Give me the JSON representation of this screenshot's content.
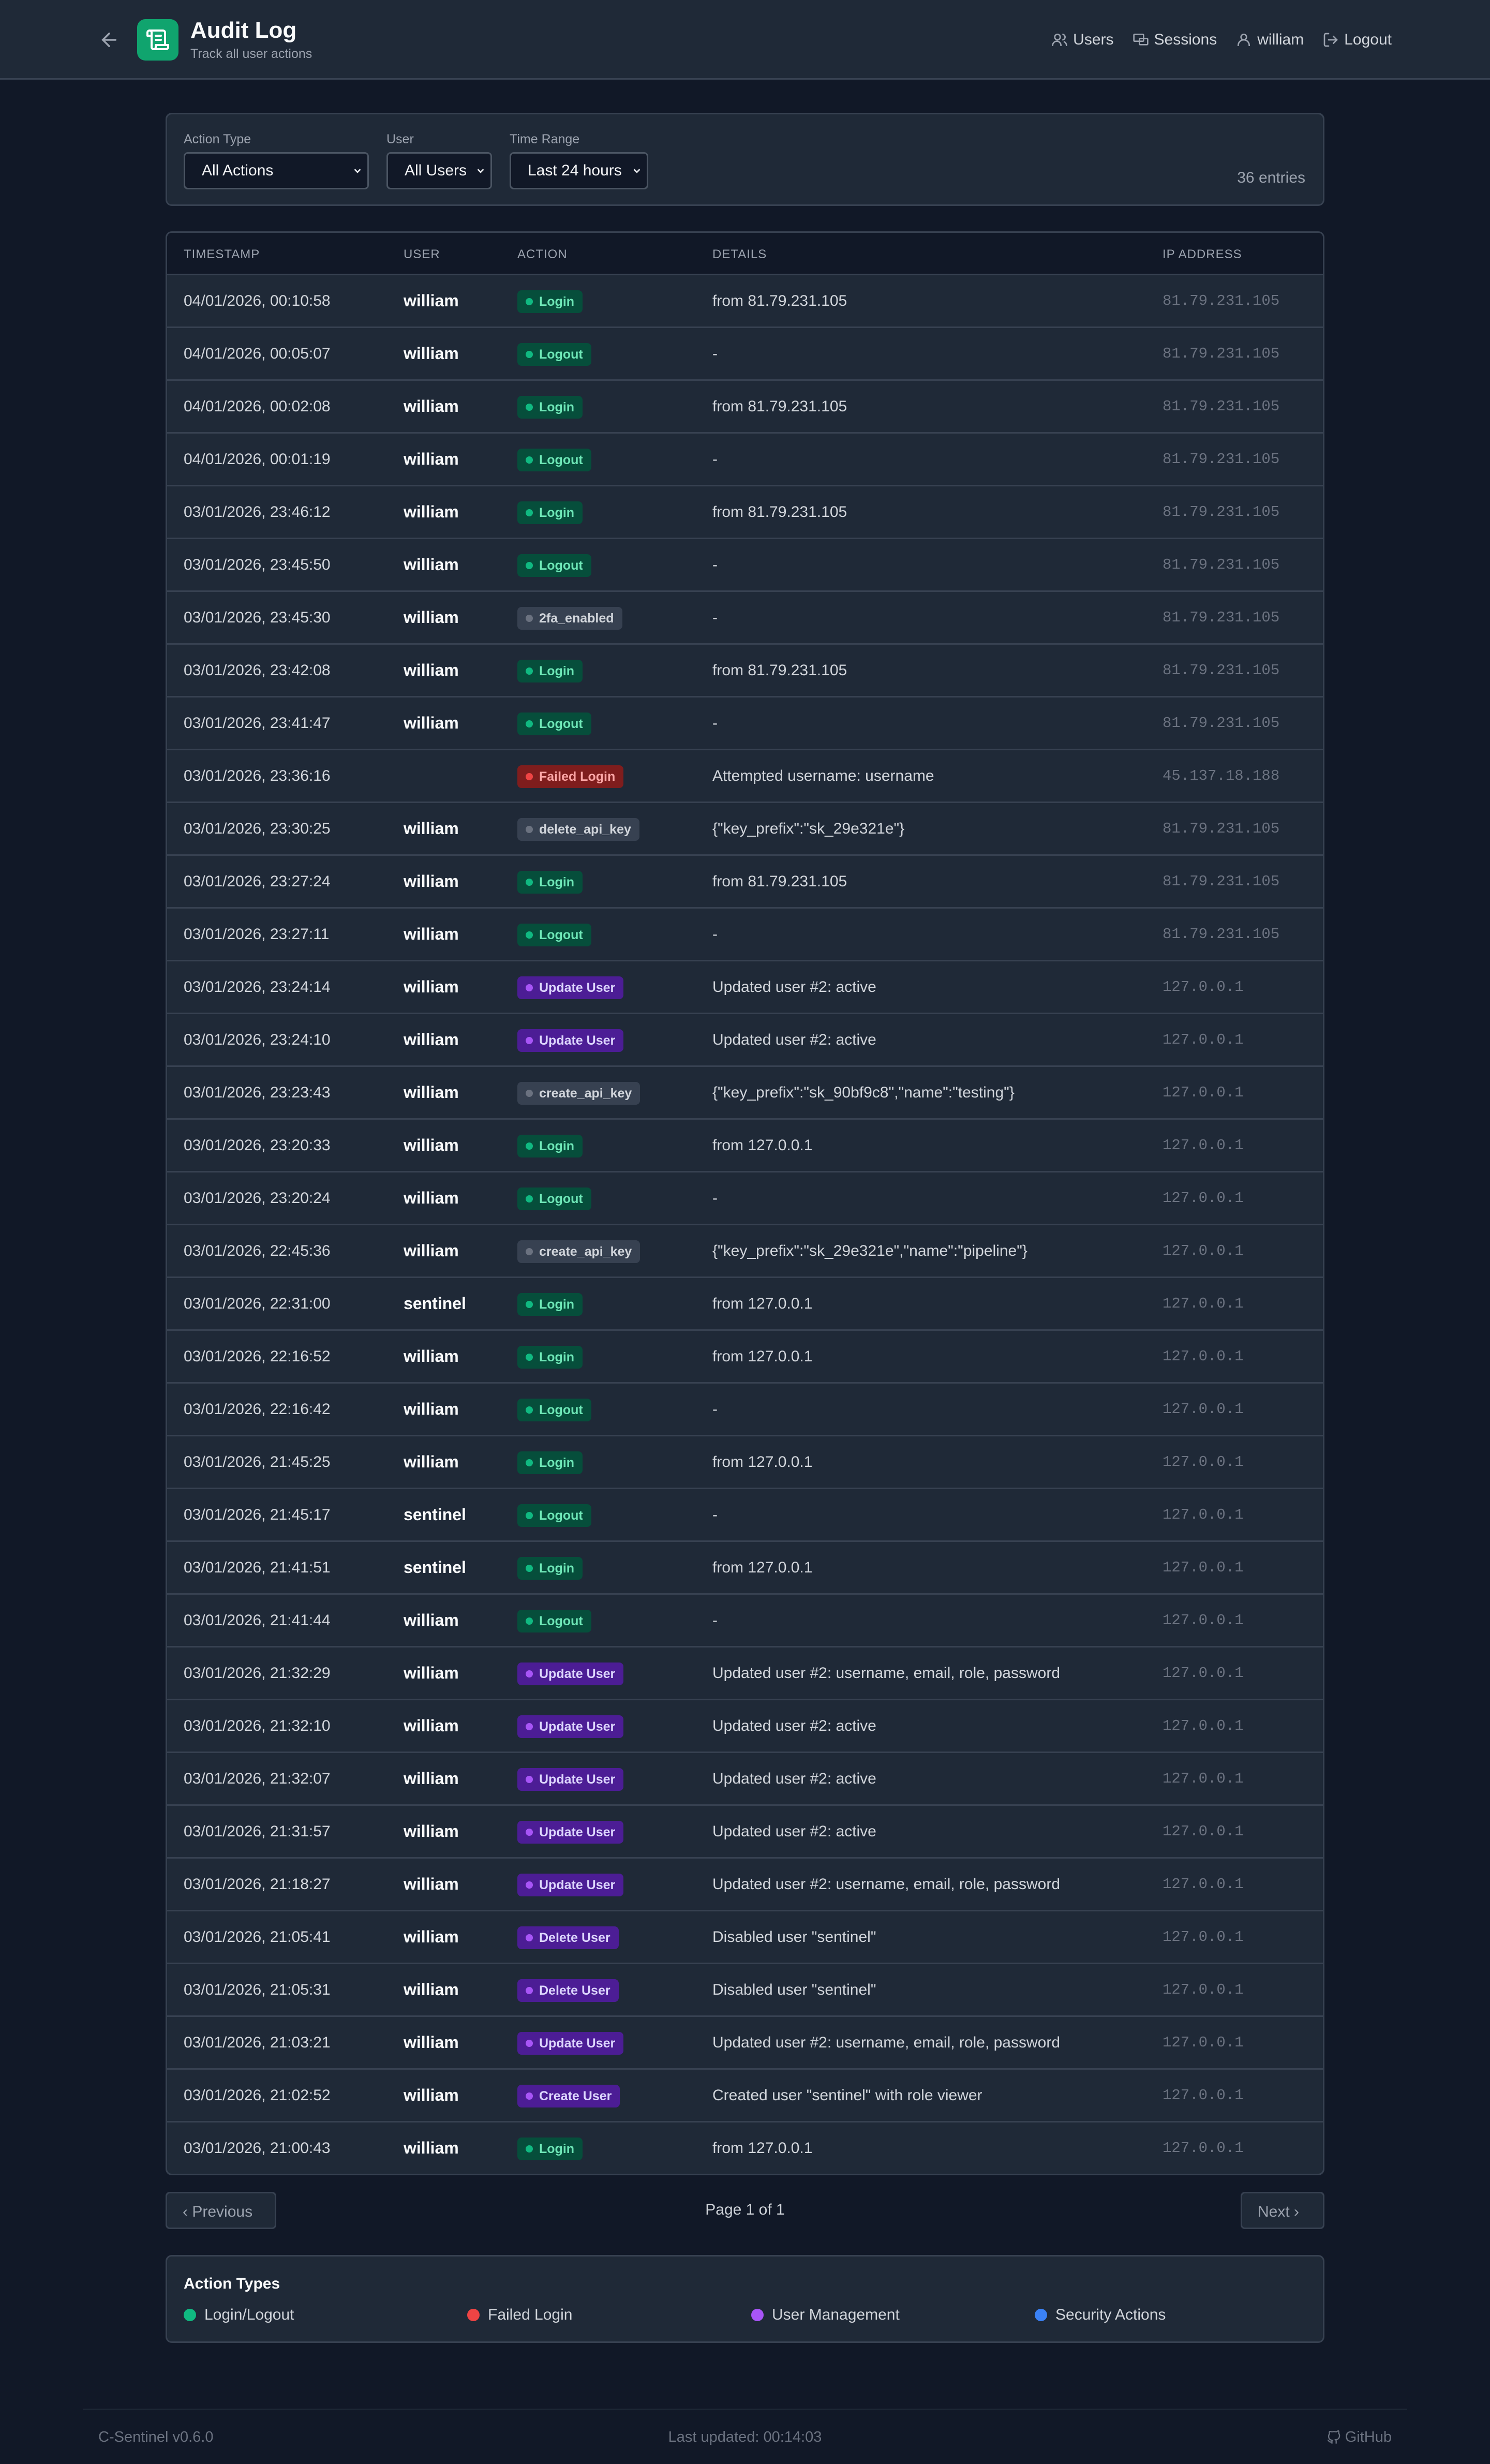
{
  "header": {
    "title": "Audit Log",
    "subtitle": "Track all user actions",
    "nav": [
      {
        "label": "Users",
        "icon": "users-icon"
      },
      {
        "label": "Sessions",
        "icon": "sessions-icon"
      },
      {
        "label": "william",
        "icon": "user-icon"
      },
      {
        "label": "Logout",
        "icon": "logout-icon"
      }
    ]
  },
  "filters": {
    "action_type_label": "Action Type",
    "action_type_value": "All Actions",
    "user_label": "User",
    "user_value": "All Users",
    "time_range_label": "Time Range",
    "time_range_value": "Last 24 hours",
    "entries": "36 entries"
  },
  "table": {
    "columns": [
      "TIMESTAMP",
      "USER",
      "ACTION",
      "DETAILS",
      "IP ADDRESS"
    ],
    "rows": [
      {
        "ts": "04/01/2026, 00:10:58",
        "user": "william",
        "action": "Login",
        "kind": "login",
        "details": "from 81.79.231.105",
        "ip": "81.79.231.105"
      },
      {
        "ts": "04/01/2026, 00:05:07",
        "user": "william",
        "action": "Logout",
        "kind": "login",
        "details": "-",
        "ip": "81.79.231.105"
      },
      {
        "ts": "04/01/2026, 00:02:08",
        "user": "william",
        "action": "Login",
        "kind": "login",
        "details": "from 81.79.231.105",
        "ip": "81.79.231.105"
      },
      {
        "ts": "04/01/2026, 00:01:19",
        "user": "william",
        "action": "Logout",
        "kind": "login",
        "details": "-",
        "ip": "81.79.231.105"
      },
      {
        "ts": "03/01/2026, 23:46:12",
        "user": "william",
        "action": "Login",
        "kind": "login",
        "details": "from 81.79.231.105",
        "ip": "81.79.231.105"
      },
      {
        "ts": "03/01/2026, 23:45:50",
        "user": "william",
        "action": "Logout",
        "kind": "login",
        "details": "-",
        "ip": "81.79.231.105"
      },
      {
        "ts": "03/01/2026, 23:45:30",
        "user": "william",
        "action": "2fa_enabled",
        "kind": "other",
        "details": "-",
        "ip": "81.79.231.105"
      },
      {
        "ts": "03/01/2026, 23:42:08",
        "user": "william",
        "action": "Login",
        "kind": "login",
        "details": "from 81.79.231.105",
        "ip": "81.79.231.105"
      },
      {
        "ts": "03/01/2026, 23:41:47",
        "user": "william",
        "action": "Logout",
        "kind": "login",
        "details": "-",
        "ip": "81.79.231.105"
      },
      {
        "ts": "03/01/2026, 23:36:16",
        "user": "",
        "action": "Failed Login",
        "kind": "failed",
        "details": "Attempted username: username",
        "ip": "45.137.18.188"
      },
      {
        "ts": "03/01/2026, 23:30:25",
        "user": "william",
        "action": "delete_api_key",
        "kind": "other",
        "details": "{\"key_prefix\":\"sk_29e321e\"}",
        "ip": "81.79.231.105"
      },
      {
        "ts": "03/01/2026, 23:27:24",
        "user": "william",
        "action": "Login",
        "kind": "login",
        "details": "from 81.79.231.105",
        "ip": "81.79.231.105"
      },
      {
        "ts": "03/01/2026, 23:27:11",
        "user": "william",
        "action": "Logout",
        "kind": "login",
        "details": "-",
        "ip": "81.79.231.105"
      },
      {
        "ts": "03/01/2026, 23:24:14",
        "user": "william",
        "action": "Update User",
        "kind": "user",
        "details": "Updated user #2: active",
        "ip": "127.0.0.1"
      },
      {
        "ts": "03/01/2026, 23:24:10",
        "user": "william",
        "action": "Update User",
        "kind": "user",
        "details": "Updated user #2: active",
        "ip": "127.0.0.1"
      },
      {
        "ts": "03/01/2026, 23:23:43",
        "user": "william",
        "action": "create_api_key",
        "kind": "other",
        "details": "{\"key_prefix\":\"sk_90bf9c8\",\"name\":\"testing\"}",
        "ip": "127.0.0.1"
      },
      {
        "ts": "03/01/2026, 23:20:33",
        "user": "william",
        "action": "Login",
        "kind": "login",
        "details": "from 127.0.0.1",
        "ip": "127.0.0.1"
      },
      {
        "ts": "03/01/2026, 23:20:24",
        "user": "william",
        "action": "Logout",
        "kind": "login",
        "details": "-",
        "ip": "127.0.0.1"
      },
      {
        "ts": "03/01/2026, 22:45:36",
        "user": "william",
        "action": "create_api_key",
        "kind": "other",
        "details": "{\"key_prefix\":\"sk_29e321e\",\"name\":\"pipeline\"}",
        "ip": "127.0.0.1"
      },
      {
        "ts": "03/01/2026, 22:31:00",
        "user": "sentinel",
        "action": "Login",
        "kind": "login",
        "details": "from 127.0.0.1",
        "ip": "127.0.0.1"
      },
      {
        "ts": "03/01/2026, 22:16:52",
        "user": "william",
        "action": "Login",
        "kind": "login",
        "details": "from 127.0.0.1",
        "ip": "127.0.0.1"
      },
      {
        "ts": "03/01/2026, 22:16:42",
        "user": "william",
        "action": "Logout",
        "kind": "login",
        "details": "-",
        "ip": "127.0.0.1"
      },
      {
        "ts": "03/01/2026, 21:45:25",
        "user": "william",
        "action": "Login",
        "kind": "login",
        "details": "from 127.0.0.1",
        "ip": "127.0.0.1"
      },
      {
        "ts": "03/01/2026, 21:45:17",
        "user": "sentinel",
        "action": "Logout",
        "kind": "login",
        "details": "-",
        "ip": "127.0.0.1"
      },
      {
        "ts": "03/01/2026, 21:41:51",
        "user": "sentinel",
        "action": "Login",
        "kind": "login",
        "details": "from 127.0.0.1",
        "ip": "127.0.0.1"
      },
      {
        "ts": "03/01/2026, 21:41:44",
        "user": "william",
        "action": "Logout",
        "kind": "login",
        "details": "-",
        "ip": "127.0.0.1"
      },
      {
        "ts": "03/01/2026, 21:32:29",
        "user": "william",
        "action": "Update User",
        "kind": "user",
        "details": "Updated user #2: username, email, role, password",
        "ip": "127.0.0.1"
      },
      {
        "ts": "03/01/2026, 21:32:10",
        "user": "william",
        "action": "Update User",
        "kind": "user",
        "details": "Updated user #2: active",
        "ip": "127.0.0.1"
      },
      {
        "ts": "03/01/2026, 21:32:07",
        "user": "william",
        "action": "Update User",
        "kind": "user",
        "details": "Updated user #2: active",
        "ip": "127.0.0.1"
      },
      {
        "ts": "03/01/2026, 21:31:57",
        "user": "william",
        "action": "Update User",
        "kind": "user",
        "details": "Updated user #2: active",
        "ip": "127.0.0.1"
      },
      {
        "ts": "03/01/2026, 21:18:27",
        "user": "william",
        "action": "Update User",
        "kind": "user",
        "details": "Updated user #2: username, email, role, password",
        "ip": "127.0.0.1"
      },
      {
        "ts": "03/01/2026, 21:05:41",
        "user": "william",
        "action": "Delete User",
        "kind": "user",
        "details": "Disabled user \"sentinel\"",
        "ip": "127.0.0.1"
      },
      {
        "ts": "03/01/2026, 21:05:31",
        "user": "william",
        "action": "Delete User",
        "kind": "user",
        "details": "Disabled user \"sentinel\"",
        "ip": "127.0.0.1"
      },
      {
        "ts": "03/01/2026, 21:03:21",
        "user": "william",
        "action": "Update User",
        "kind": "user",
        "details": "Updated user #2: username, email, role, password",
        "ip": "127.0.0.1"
      },
      {
        "ts": "03/01/2026, 21:02:52",
        "user": "william",
        "action": "Create User",
        "kind": "user",
        "details": "Created user \"sentinel\" with role viewer",
        "ip": "127.0.0.1"
      },
      {
        "ts": "03/01/2026, 21:00:43",
        "user": "william",
        "action": "Login",
        "kind": "login",
        "details": "from 127.0.0.1",
        "ip": "127.0.0.1"
      }
    ]
  },
  "badge_colors": {
    "login": {
      "bg": "#064e3b",
      "fg": "#6ee7b7",
      "dot": "#10b981"
    },
    "failed": {
      "bg": "#7f1d1d",
      "fg": "#fca5a5",
      "dot": "#ef4444"
    },
    "user": {
      "bg": "#4c1d95",
      "fg": "#ddd6fe",
      "dot": "#a855f7"
    },
    "other": {
      "bg": "#374151",
      "fg": "#d1d5db",
      "dot": "#6b7280"
    }
  },
  "pagination": {
    "prev_label": "Previous",
    "next_label": "Next",
    "page_text": "Page 1 of 1"
  },
  "legend": {
    "title": "Action Types",
    "items": [
      {
        "label": "Login/Logout",
        "color": "#10b981"
      },
      {
        "label": "Failed Login",
        "color": "#ef4444"
      },
      {
        "label": "User Management",
        "color": "#a855f7"
      },
      {
        "label": "Security Actions",
        "color": "#3b82f6"
      }
    ]
  },
  "footer": {
    "version": "C-Sentinel v0.6.0",
    "last_updated": "Last updated: 00:14:03",
    "github": "GitHub"
  }
}
